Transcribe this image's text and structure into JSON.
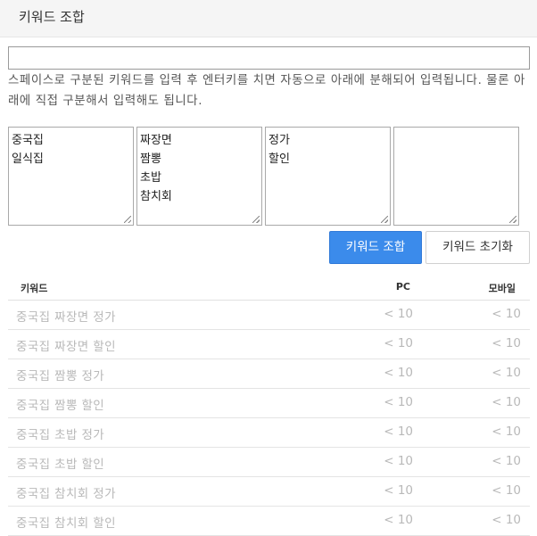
{
  "header": {
    "title": "키워드 조합"
  },
  "input": {
    "value": "",
    "placeholder": ""
  },
  "description": "스페이스로 구분된 키워드를 입력 후 엔터키를 치면 자동으로 아래에 분해되어 입력됩니다. 물론 아래에 직접 구분해서 입력해도 됩니다.",
  "boxes": [
    [
      "중국집",
      "일식집"
    ],
    [
      "짜장면",
      "짬뽕",
      "초밥",
      "참치회"
    ],
    [
      "정가",
      "할인"
    ],
    []
  ],
  "buttons": {
    "combine": "키워드 조합",
    "reset": "키워드 초기화"
  },
  "table": {
    "headers": {
      "keyword": "키워드",
      "pc": "PC",
      "mobile": "모바일"
    },
    "rows": [
      {
        "keyword": "중국집 짜장면 정가",
        "pc": "< 10",
        "mobile": "< 10"
      },
      {
        "keyword": "중국집 짜장면 할인",
        "pc": "< 10",
        "mobile": "< 10"
      },
      {
        "keyword": "중국집 짬뽕 정가",
        "pc": "< 10",
        "mobile": "< 10"
      },
      {
        "keyword": "중국집 짬뽕 할인",
        "pc": "< 10",
        "mobile": "< 10"
      },
      {
        "keyword": "중국집 초밥 정가",
        "pc": "< 10",
        "mobile": "< 10"
      },
      {
        "keyword": "중국집 초밥 할인",
        "pc": "< 10",
        "mobile": "< 10"
      },
      {
        "keyword": "중국집 참치회 정가",
        "pc": "< 10",
        "mobile": "< 10"
      },
      {
        "keyword": "중국집 참치회 할인",
        "pc": "< 10",
        "mobile": "< 10"
      }
    ]
  },
  "colors": {
    "primary": "#3b8beb",
    "header_bg": "#f5f5f5",
    "muted_text": "#b9b9b9"
  }
}
